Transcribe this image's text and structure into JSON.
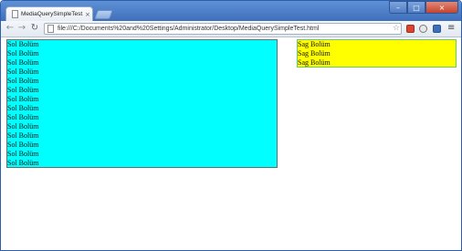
{
  "browser": {
    "tab_title": "MediaQuerySimpleTest.html",
    "close_symbol": "×",
    "url": "file:///C:/Documents%20and%20Settings/Administrator/Desktop/MediaQuerySimpleTest.html",
    "nav": {
      "back": "←",
      "forward": "→",
      "reload": "↻"
    },
    "star": "☆",
    "menu": "≡",
    "window_buttons": {
      "minimize": "–",
      "maximize": "□",
      "close": "×"
    }
  },
  "page": {
    "left_section": {
      "background": "#00ffff",
      "lines": [
        "Sol Bolüm",
        "Sol Bolüm",
        "Sol Bolüm",
        "Sol Bolüm",
        "Sol Bolüm",
        "Sol Bolüm",
        "Sol Bolüm",
        "Sol Bolüm",
        "Sol Bolüm",
        "Sol Bolüm",
        "Sol Bolüm",
        "Sol Bolüm",
        "Sol Bolüm",
        "Sol Bolüm"
      ]
    },
    "right_section": {
      "background": "#ffff00",
      "lines": [
        "Sag Bolüm",
        "Sag Bolüm",
        "Sag Bolüm"
      ]
    }
  }
}
